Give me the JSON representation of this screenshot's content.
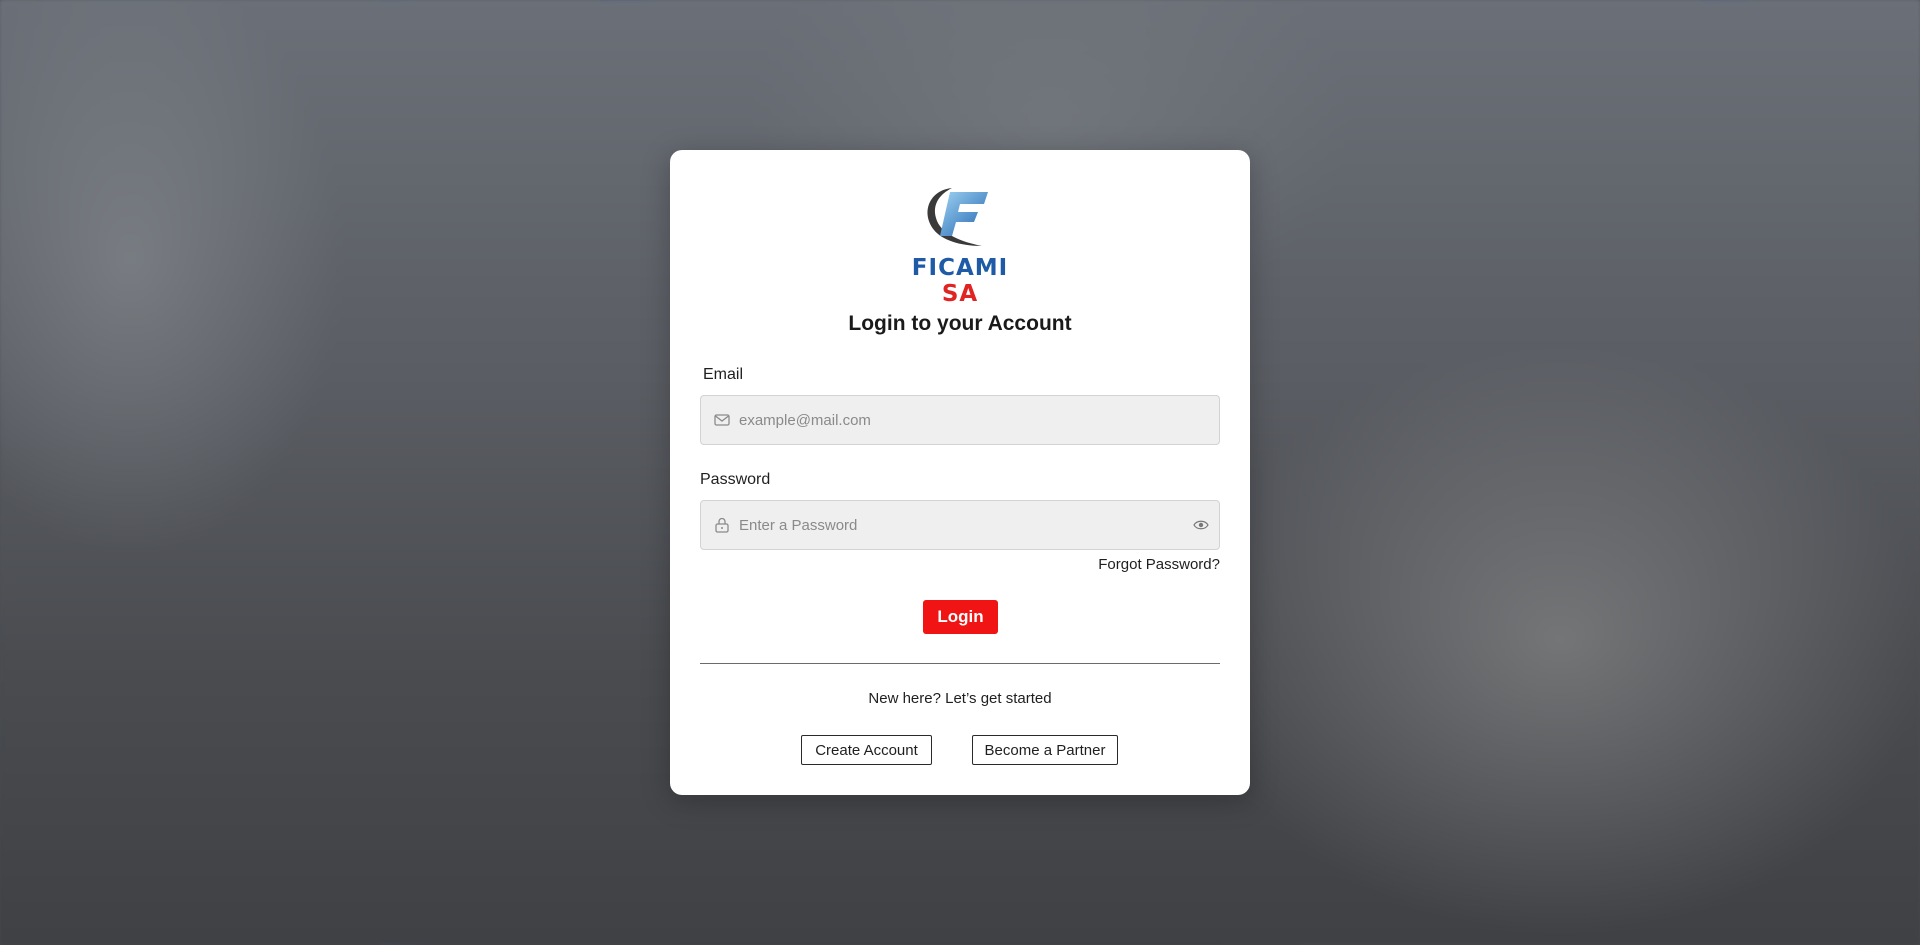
{
  "brand": {
    "name_part1": "FICAMI",
    "name_part2": "SA",
    "logo_icon": "ficami-f-swoosh-logo",
    "primary_color": "#1f5aa6",
    "accent_color": "#e02424"
  },
  "login": {
    "title": "Login to your Account",
    "email": {
      "label": "Email",
      "placeholder": "example@mail.com",
      "value": "",
      "icon": "mail-icon"
    },
    "password": {
      "label": "Password",
      "placeholder": "Enter a Password",
      "value": "",
      "icon": "lock-icon",
      "toggle_icon": "eye-icon"
    },
    "forgot_label": "Forgot Password?",
    "submit_label": "Login",
    "submit_color": "#f01414"
  },
  "signup": {
    "prompt": "New here? Let’s get started",
    "create_account_label": "Create Account",
    "become_partner_label": "Become a Partner"
  }
}
